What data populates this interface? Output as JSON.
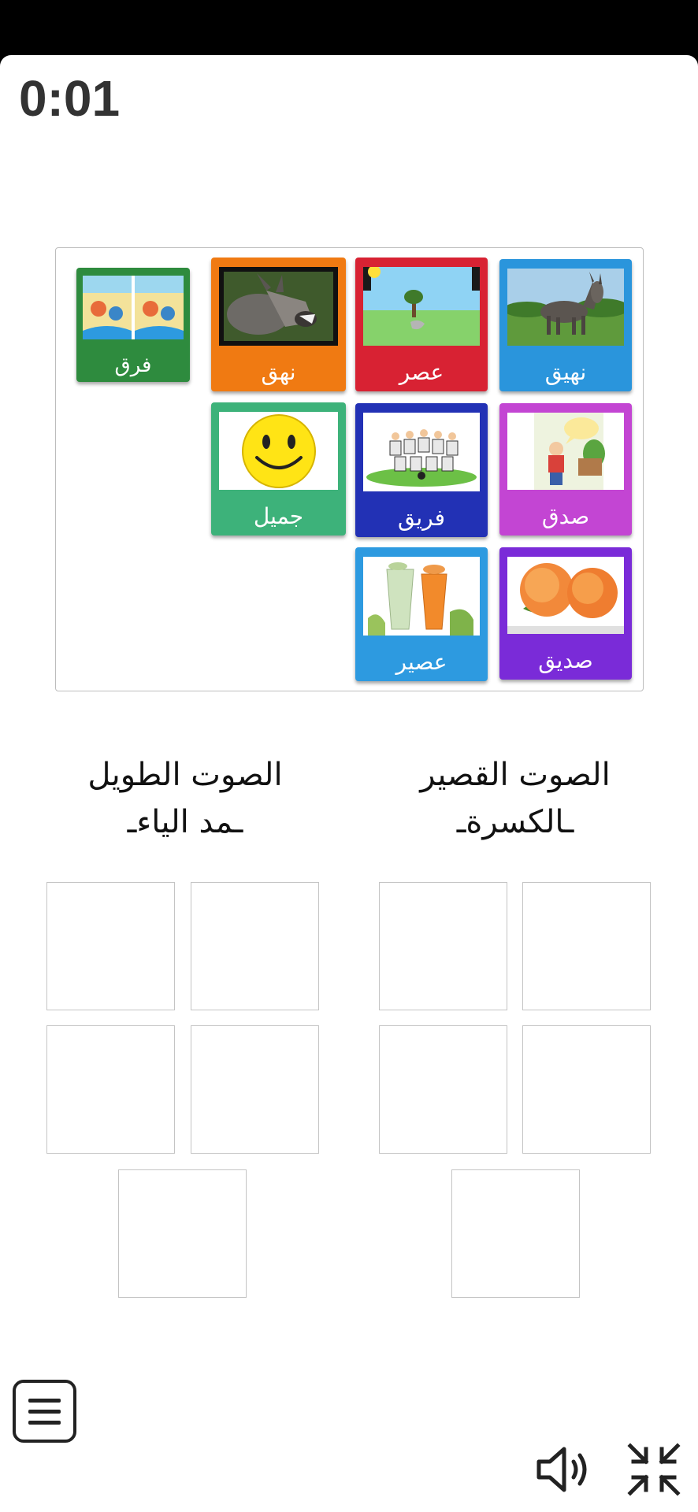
{
  "timer": "0:01",
  "colors": {
    "green": "#2e8b3e",
    "orange": "#f07a12",
    "red": "#d82233",
    "blue": "#2a95dc",
    "navy": "#2231b5",
    "teal": "#3db27a",
    "magenta": "#c345d3",
    "purple": "#7a2bd8",
    "skyblue": "#2d9ae0"
  },
  "cards": [
    {
      "label": "نهيق",
      "icon": "donkey-photo"
    },
    {
      "label": "عصر",
      "icon": "afternoon-sun-scene"
    },
    {
      "label": "نهق",
      "icon": "braying-donkey-photo"
    },
    {
      "label": "فرق",
      "icon": "spot-the-difference-picture"
    },
    {
      "label": "صدق",
      "icon": "truth-speech-bubble"
    },
    {
      "label": "فريق",
      "icon": "football-team-photo"
    },
    {
      "label": "جميل",
      "icon": "smiley-face"
    },
    {
      "label": "صديق",
      "icon": "peaches-photo"
    },
    {
      "label": "عصير",
      "icon": "juice-glasses-photo"
    }
  ],
  "categories": [
    {
      "line1": "الصوت القصير",
      "line2": "ـالكسرةـ"
    },
    {
      "line1": "الصوت الطويل",
      "line2": "ـمد الياءـ"
    }
  ],
  "controls": {
    "menu_icon": "menu-icon",
    "sound_icon": "speaker-icon",
    "exit_fullscreen_icon": "exit-fullscreen-icon"
  }
}
